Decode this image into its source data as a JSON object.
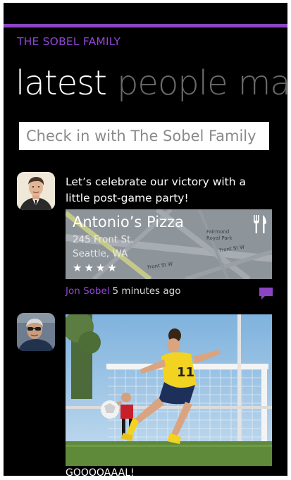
{
  "header": {
    "group_title": "THE SOBEL FAMILY",
    "pivot_tabs": [
      {
        "label": "latest",
        "active": true
      },
      {
        "label": "people",
        "active": false
      },
      {
        "label": "ma",
        "active": false
      }
    ]
  },
  "checkin": {
    "placeholder": "Check in with The Sobel Family"
  },
  "posts": [
    {
      "text": "Let’s celebrate our victory with a little post-game party!",
      "place": {
        "name": "Antonio’s Pizza",
        "address_line1": "245 Front St.",
        "address_line2": "Seattle, WA",
        "rating_stars": "★★★★",
        "rating": 4,
        "icon": "fork-knife-icon",
        "map_labels": [
          "Fairmond Royal Park",
          "Front St W",
          "Front St W"
        ]
      },
      "author": "Jon Sobel",
      "time": "5 minutes ago",
      "comment_icon": "comment-icon"
    },
    {
      "photo": "soccer-kick-photo",
      "caption": "GOOOOAAAL!"
    }
  ],
  "colors": {
    "accent": "#8b44c4",
    "background": "#000000"
  }
}
